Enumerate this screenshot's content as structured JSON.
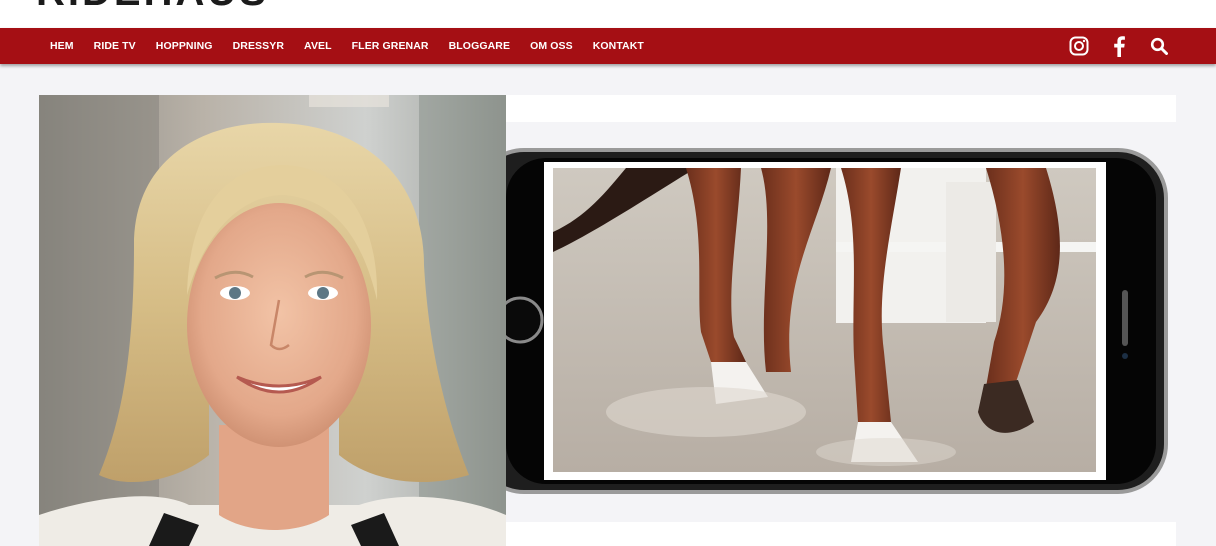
{
  "site": {
    "logo_text": "RIDEHAUS"
  },
  "nav": {
    "items": [
      {
        "label": "HEM"
      },
      {
        "label": "RIDE TV"
      },
      {
        "label": "HOPPNING"
      },
      {
        "label": "DRESSYR"
      },
      {
        "label": "AVEL"
      },
      {
        "label": "FLER GRENAR"
      },
      {
        "label": "BLOGGARE"
      },
      {
        "label": "OM OSS"
      },
      {
        "label": "KONTAKT"
      }
    ],
    "icons": [
      "instagram-icon",
      "facebook-icon",
      "search-icon"
    ]
  },
  "colors": {
    "nav_background": "#a50f14",
    "nav_text": "#ffffff",
    "page_background": "#f4f4f7"
  }
}
